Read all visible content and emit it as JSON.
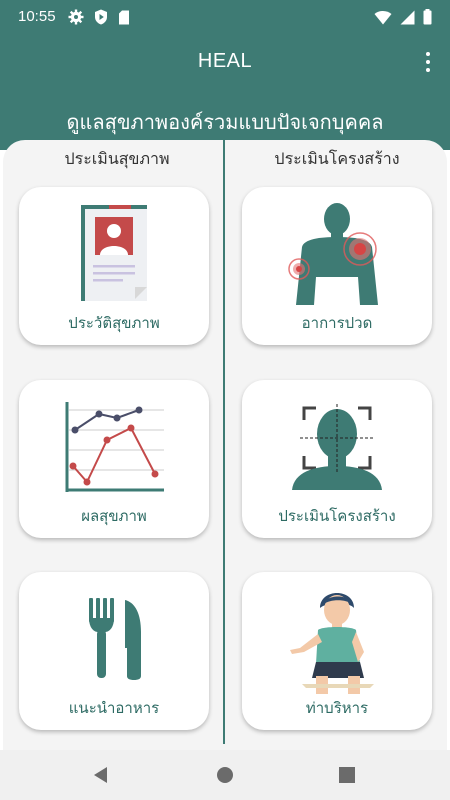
{
  "status_bar": {
    "time": "10:55",
    "icons": [
      "gear-icon",
      "shield-play-icon",
      "sd-card-icon",
      "wifi-icon",
      "signal-icon",
      "battery-icon"
    ]
  },
  "app_bar": {
    "title": "HEAL",
    "menu_icon": "more-vert-icon"
  },
  "banner": {
    "text": "ดูแลสุขภาพองค์รวมแบบปัจเจกบุคคล"
  },
  "columns": {
    "left_header": "ประเมินสุขภาพ",
    "right_header": "ประเมินโครงสร้าง"
  },
  "cards": {
    "health_history": {
      "label": "ประวัติสุขภาพ",
      "icon": "medical-record-icon"
    },
    "pain_symptoms": {
      "label": "อาการปวด",
      "icon": "body-pain-icon"
    },
    "health_results": {
      "label": "ผลสุขภาพ",
      "icon": "line-chart-icon"
    },
    "structure_assessment": {
      "label": "ประเมินโครงสร้าง",
      "icon": "posture-scan-icon"
    },
    "diet_advice": {
      "label": "แนะนำอาหาร",
      "icon": "fork-knife-icon"
    },
    "exercise": {
      "label": "ท่าบริหาร",
      "icon": "exercise-person-icon"
    }
  },
  "nav": {
    "back_icon": "back-triangle-icon",
    "home_icon": "home-circle-icon",
    "recents_icon": "recents-square-icon"
  },
  "colors": {
    "primary": "#3e7b74",
    "accent_red": "#c44a4a",
    "label_text": "#2e6b64"
  }
}
